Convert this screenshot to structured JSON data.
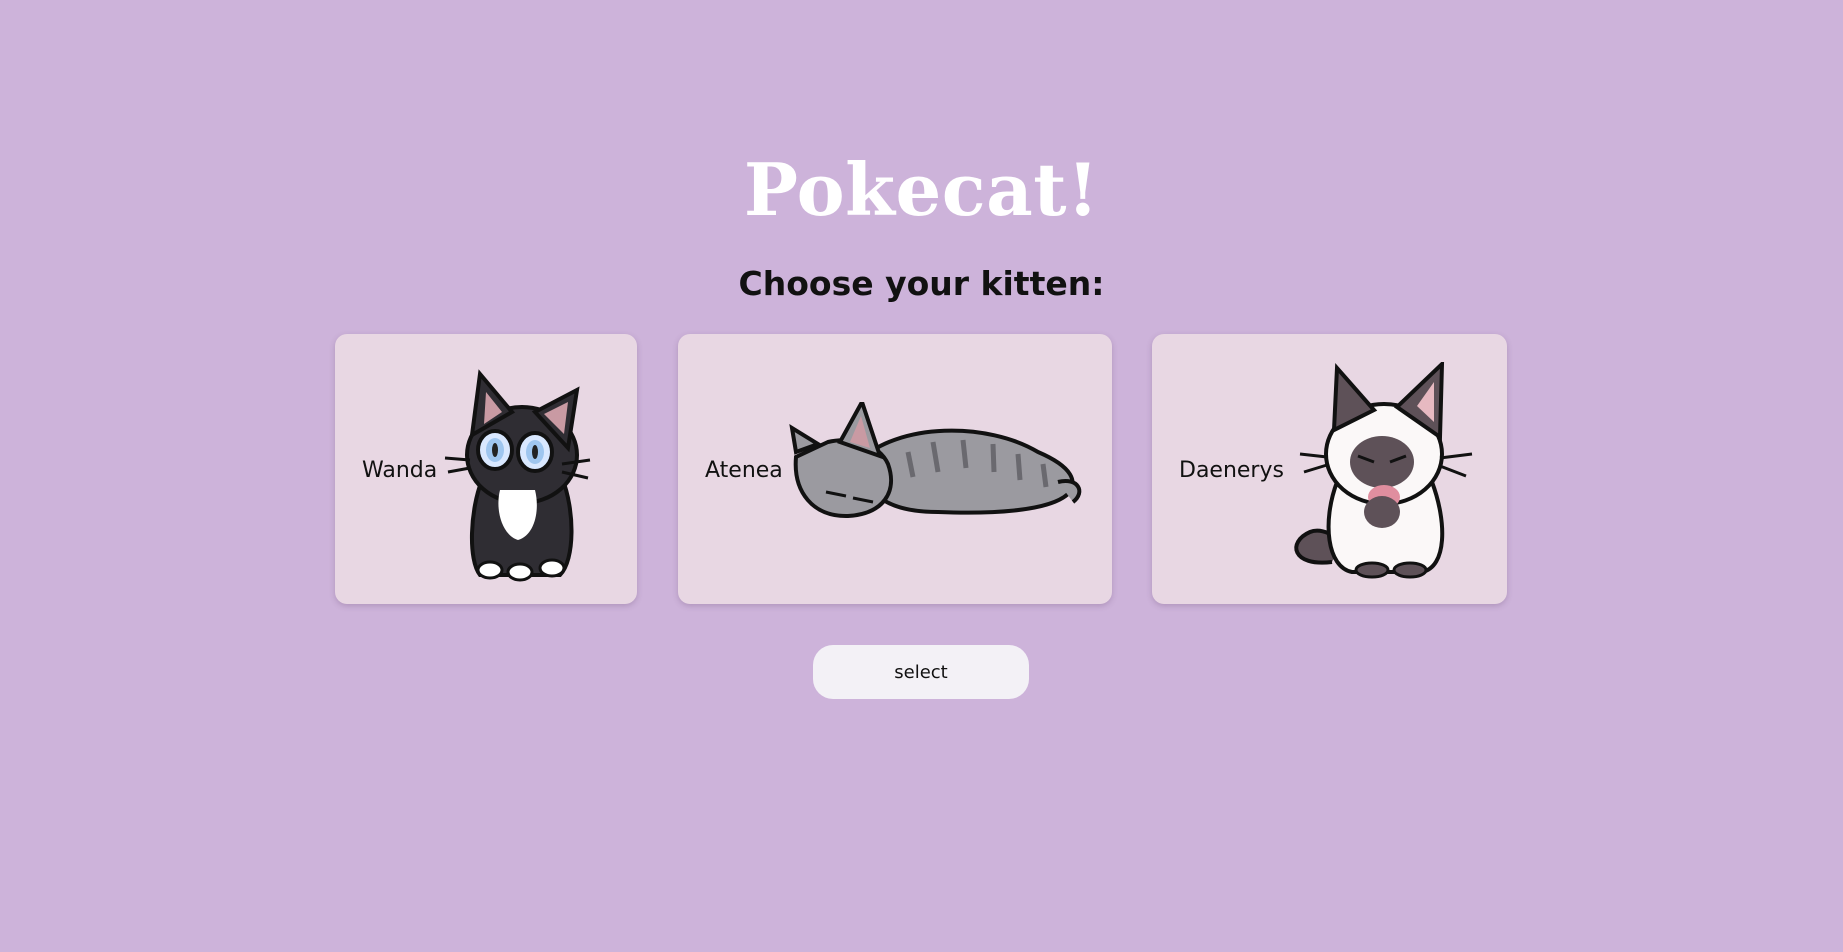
{
  "title": "Pokecat!",
  "subtitle": "Choose your kitten:",
  "kittens": [
    {
      "name": "Wanda",
      "icon": "tuxedo-cat-icon"
    },
    {
      "name": "Atenea",
      "icon": "sleeping-tabby-cat-icon"
    },
    {
      "name": "Daenerys",
      "icon": "siamese-cat-icon"
    }
  ],
  "select_label": "select",
  "colors": {
    "background": "#cdb3da",
    "card": "#e8d7e3",
    "button": "#f3f1f6",
    "title": "#ffffff"
  }
}
